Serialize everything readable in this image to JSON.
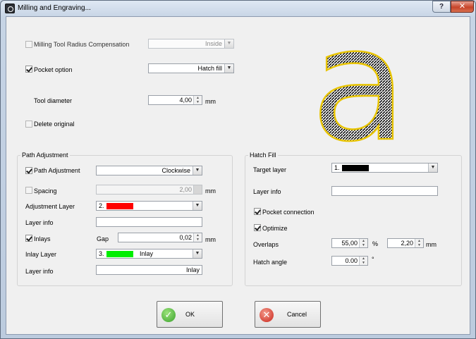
{
  "window": {
    "title": "Milling and Engraving...",
    "help_glyph": "?",
    "close_glyph": "✕"
  },
  "top": {
    "tool_radius_comp": {
      "label": "Milling Tool Radius Compensation",
      "checked": false,
      "value": "Inside"
    },
    "pocket_option": {
      "label": "Pocket option",
      "checked": true,
      "value": "Hatch fill"
    },
    "tool_diameter": {
      "label": "Tool diameter",
      "value": "4,00",
      "unit": "mm"
    },
    "delete_original": {
      "label": "Delete original",
      "checked": false
    }
  },
  "preview": {
    "glyph": "a",
    "fill_color": "#222222",
    "outline_color": "#e8c400",
    "edge_color": "#d82020"
  },
  "path_adjustment": {
    "group_title": "Path Adjustment",
    "path_adjustment": {
      "label": "Path Adjustment",
      "checked": true,
      "value": "Clockwise"
    },
    "spacing": {
      "label": "Spacing",
      "checked": false,
      "value": "2,00",
      "unit": "mm"
    },
    "adjustment_layer": {
      "label": "Adjustment Layer",
      "number": "2.",
      "color": "#ff0000"
    },
    "layer_info_1": {
      "label": "Layer info",
      "value": ""
    },
    "inlays": {
      "label": "Inlays",
      "checked": true,
      "gap_label": "Gap",
      "gap_value": "0,02",
      "unit": "mm"
    },
    "inlay_layer": {
      "label": "Inlay Layer",
      "number": "3.",
      "color": "#00ee00",
      "name": "Inlay"
    },
    "layer_info_2": {
      "label": "Layer info",
      "value": "Inlay"
    }
  },
  "hatch_fill": {
    "group_title": "Hatch Fill",
    "target_layer": {
      "label": "Target layer",
      "number": "1.",
      "color": "#000000"
    },
    "layer_info": {
      "label": "Layer info",
      "value": ""
    },
    "pocket_connection": {
      "label": "Pocket connection",
      "checked": true
    },
    "optimize": {
      "label": "Optimize",
      "checked": true
    },
    "overlaps": {
      "label": "Overlaps",
      "value1": "55,00",
      "unit1": "%",
      "value2": "2,20",
      "unit2": "mm"
    },
    "hatch_angle": {
      "label": "Hatch angle",
      "value": "0.00",
      "unit": "°"
    }
  },
  "buttons": {
    "ok": "OK",
    "cancel": "Cancel"
  }
}
